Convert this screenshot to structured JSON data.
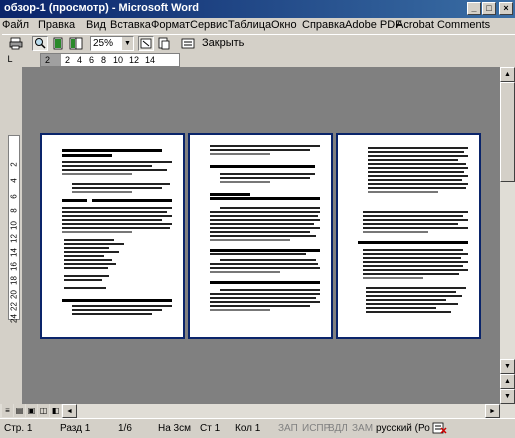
{
  "window": {
    "title": "обзор-1 (просмотр) - Microsoft Word",
    "min_label": "_",
    "max_label": "□",
    "close_label": "×"
  },
  "menu": {
    "items": [
      "Файл",
      "Правка",
      "Вид",
      "Вставка",
      "Формат",
      "Сервис",
      "Таблица",
      "Окно",
      "Справка",
      "Adobe PDF",
      "Acrobat Comments"
    ]
  },
  "toolbar": {
    "zoom_value": "25%",
    "zoom_arrow": "▼",
    "close_label": "Закрыть",
    "icons": [
      "print-icon",
      "magnifier-icon",
      "one-page-icon",
      "multiple-pages-icon",
      "zoom-icon",
      "ruler-icon",
      "shrink-to-fit-icon",
      "full-screen-icon"
    ]
  },
  "ruler": {
    "corner": "L",
    "h_marks": [
      "2",
      "2",
      "4",
      "6",
      "8",
      "10",
      "12",
      "14"
    ],
    "v_marks": [
      "2",
      "4",
      "6",
      "8",
      "10",
      "12",
      "14",
      "16",
      "18",
      "20",
      "22",
      "24"
    ]
  },
  "scroll": {
    "up": "▲",
    "down": "▼",
    "prev": "▲",
    "next": "▼",
    "left": "◄",
    "right": "►"
  },
  "status": {
    "page": "Стр. 1",
    "section": "Разд 1",
    "pages": "1/6",
    "at": "На 3см",
    "line": "Ст 1",
    "col": "Кол 1",
    "rec": "ЗАП",
    "trk": "ИСПР",
    "ext": "ВДЛ",
    "ovr": "ЗАМ",
    "lang": "русский (Ро"
  }
}
